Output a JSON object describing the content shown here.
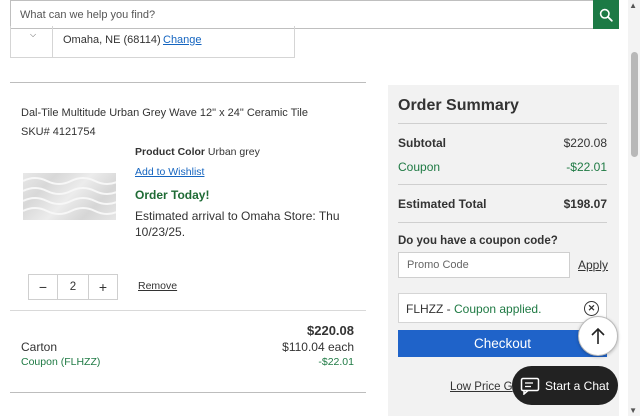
{
  "search": {
    "placeholder": "What can we help you find?"
  },
  "store": {
    "location": "Omaha, NE (68114)",
    "change_label": "Change"
  },
  "product": {
    "title": "Dal-Tile Multitude Urban Grey Wave 12\" x 24\" Ceramic Tile",
    "sku": "SKU# 4121754",
    "color_label": "Product Color",
    "color_value": "Urban grey",
    "wishlist_label": "Add to Wishlist",
    "order_today": "Order Today!",
    "arrival": "Estimated arrival to Omaha Store: Thu 10/23/25.",
    "quantity": "2",
    "remove_label": "Remove",
    "line_total": "$220.08",
    "unit_label": "Carton",
    "unit_price": "$110.04 each",
    "coupon_label": "Coupon (FLHZZ)",
    "coupon_amount": "-$22.01"
  },
  "summary": {
    "title": "Order Summary",
    "subtotal_label": "Subtotal",
    "subtotal_value": "$220.08",
    "coupon_label": "Coupon",
    "coupon_value": "-$22.01",
    "total_label": "Estimated Total",
    "total_value": "$198.07",
    "coupon_question": "Do you have a coupon code?",
    "promo_placeholder": "Promo Code",
    "apply_label": "Apply",
    "applied_code": "FLHZZ",
    "applied_sep": " - ",
    "applied_status": "Coupon applied.",
    "checkout_label": "Checkout",
    "low_price_label": "Low Price G"
  },
  "chat": {
    "label": "Start a Chat"
  },
  "colors": {
    "brand_green": "#1c7a45",
    "accent_blue": "#1f63c9",
    "success_green": "#1f7a44"
  },
  "icons": [
    "search-icon",
    "chevron-down-icon",
    "minus-icon",
    "plus-icon",
    "close-circle-icon",
    "arrow-up-icon",
    "chat-icon"
  ]
}
